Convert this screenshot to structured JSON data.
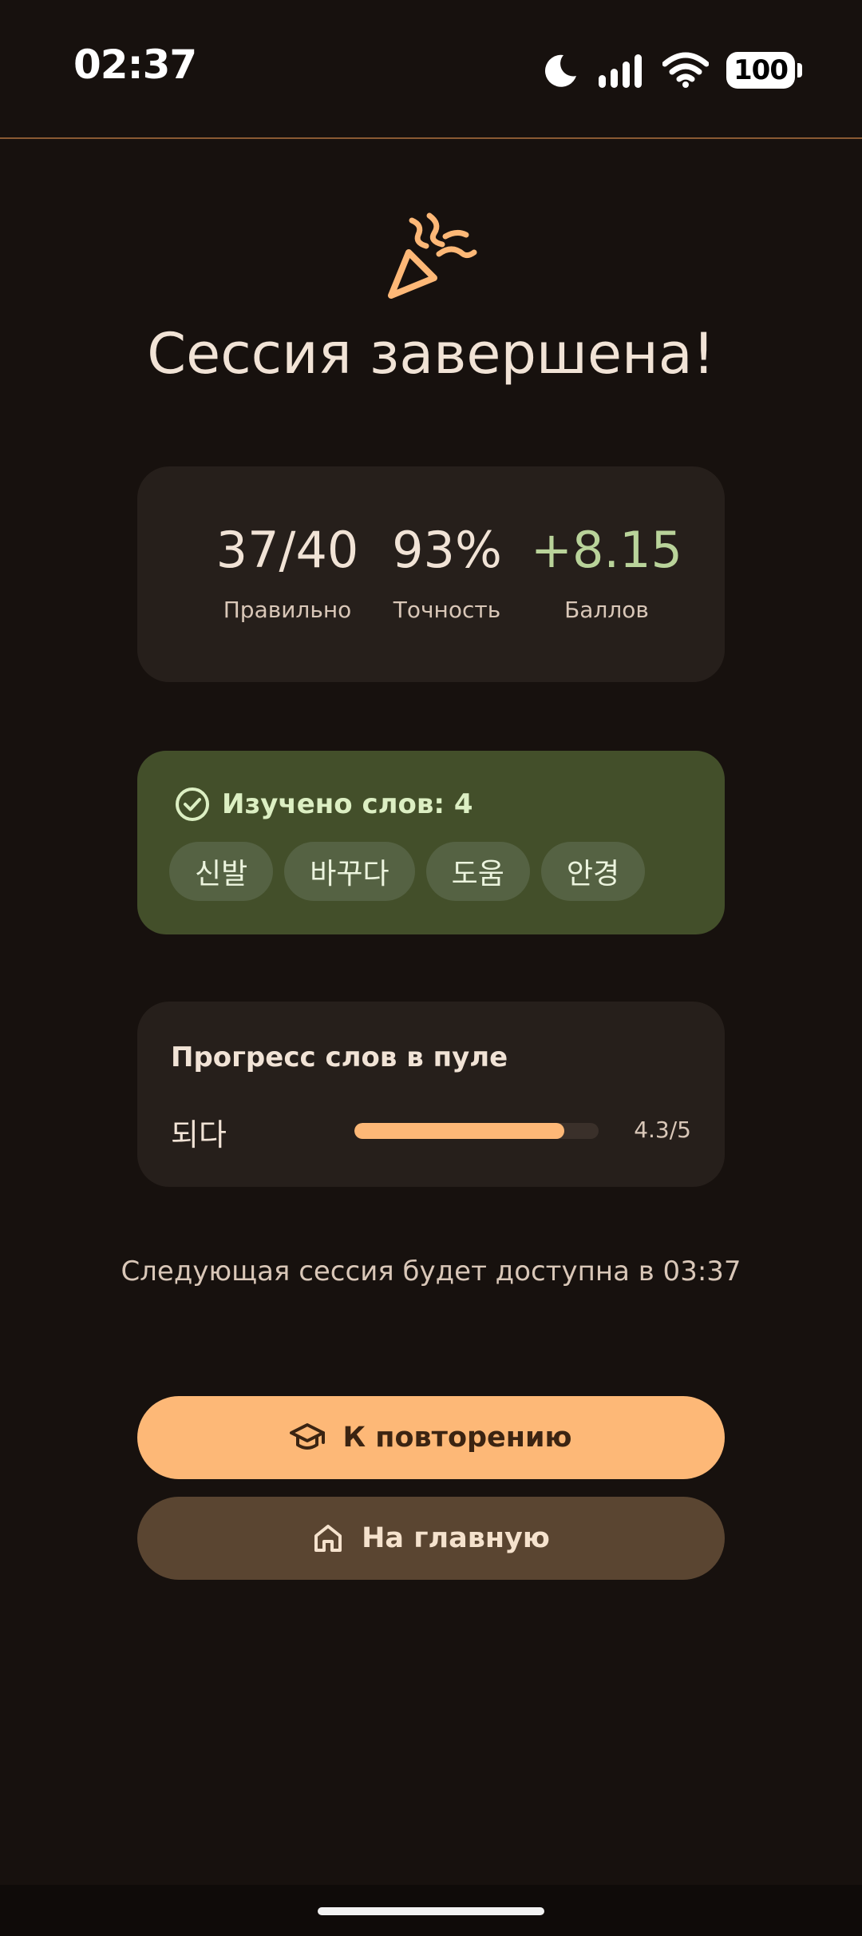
{
  "status_bar": {
    "time": "02:37",
    "battery": "100",
    "icons": [
      "moon-icon",
      "signal-icon",
      "wifi-icon",
      "battery-icon"
    ]
  },
  "hero": {
    "icon": "party-popper-icon",
    "title": "Сессия завершена!"
  },
  "stats": {
    "correct_value": "37/40",
    "correct_label": "Правильно",
    "accuracy_value": "93%",
    "accuracy_label": "Точность",
    "points_value": "+8.15",
    "points_label": "Баллов"
  },
  "learned": {
    "icon": "check-circle-icon",
    "title": "Изучено слов: 4",
    "words": [
      "신발",
      "바꾸다",
      "도움",
      "안경"
    ]
  },
  "progress": {
    "title": "Прогресс слов в пуле",
    "items": [
      {
        "word": "되다",
        "value_text": "4.3/5",
        "value": 4.3,
        "max": 5
      }
    ]
  },
  "next_session": "Следующая сессия будет доступна в 03:37",
  "buttons": {
    "review_label": "К повторению",
    "review_icon": "graduation-cap-icon",
    "home_label": "На главную",
    "home_icon": "home-icon"
  },
  "colors": {
    "background": "#17110e",
    "accent": "#fdb877",
    "success_bg": "#434f2a",
    "points": "#b9d39a"
  }
}
